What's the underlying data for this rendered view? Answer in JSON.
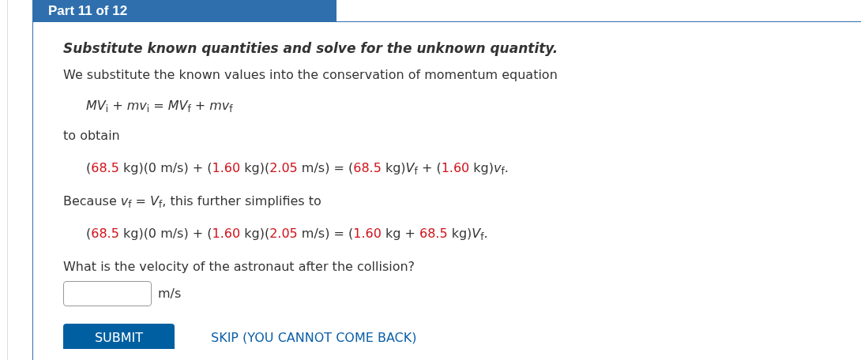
{
  "part_header": "Part 11 of 12",
  "step_title": "Substitute known quantities and solve for the unknown quantity.",
  "intro": "We substitute the known values into the conservation of momentum equation",
  "equation": "*MV*$_{i}$ + *mv*$_{i}$ = *MV*$_{f}$ + *mv*$_{f}$",
  "connector": "to obtain",
  "substituted_equation": [
    {
      "kind": "plain",
      "text": "("
    },
    {
      "kind": "given",
      "text": "68.5"
    },
    {
      "kind": "plain",
      "text": " kg)(0 m/s) + ("
    },
    {
      "kind": "given",
      "text": "1.60"
    },
    {
      "kind": "plain",
      "text": " kg)("
    },
    {
      "kind": "given",
      "text": "2.05"
    },
    {
      "kind": "plain",
      "text": " m/s) = ("
    },
    {
      "kind": "given",
      "text": "68.5"
    },
    {
      "kind": "plain",
      "text": " kg)*V*$_{f}$ + ("
    },
    {
      "kind": "given",
      "text": "1.60"
    },
    {
      "kind": "plain",
      "text": " kg)*v*$_{f}$."
    }
  ],
  "simplify_note": "Because *v*$_{f}$ = *V*$_{f}$, this further simplifies to",
  "simplified_equation": [
    {
      "kind": "plain",
      "text": "("
    },
    {
      "kind": "given",
      "text": "68.5"
    },
    {
      "kind": "plain",
      "text": " kg)(0 m/s) + ("
    },
    {
      "kind": "given",
      "text": "1.60"
    },
    {
      "kind": "plain",
      "text": " kg)("
    },
    {
      "kind": "given",
      "text": "2.05"
    },
    {
      "kind": "plain",
      "text": " m/s) = ("
    },
    {
      "kind": "given",
      "text": "1.60"
    },
    {
      "kind": "plain",
      "text": " kg + "
    },
    {
      "kind": "given",
      "text": "68.5"
    },
    {
      "kind": "plain",
      "text": " kg)*V*$_{f}$."
    }
  ],
  "question": "What is the velocity of the astronaut after the collision?",
  "answer": {
    "unit": "m/s"
  },
  "buttons": {
    "submit": "SUBMIT",
    "skip": "SKIP (YOU CANNOT COME BACK)"
  }
}
